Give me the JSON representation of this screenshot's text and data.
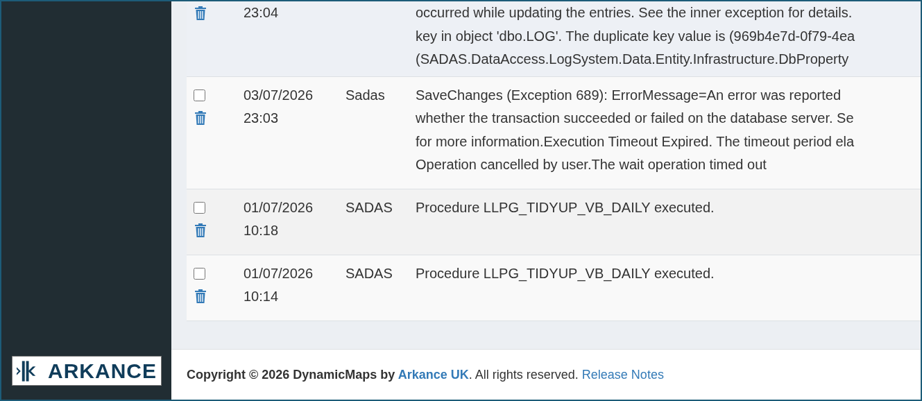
{
  "sidebar": {
    "logo_text": "ARKANCE"
  },
  "log_table": {
    "rows": [
      {
        "date": "",
        "time": "23:04",
        "user": "",
        "highlighted": true,
        "message_lines": [
          "occurred while updating the entries. See the inner exception for details.",
          "key in object 'dbo.LOG'. The duplicate key value is (969b4e7d-0f79-4ea",
          "(SADAS.DataAccess.LogSystem.Data.Entity.Infrastructure.DbProperty"
        ]
      },
      {
        "checked": false,
        "date": "03/07/2026",
        "time": "23:03",
        "user": "Sadas",
        "highlighted": false,
        "message_lines": [
          "SaveChanges (Exception 689): ErrorMessage=An error was reported",
          "whether the transaction succeeded or failed on the database server. Se",
          "for more information.Execution Timeout Expired. The timeout period ela",
          "Operation cancelled by user.The wait operation timed out"
        ]
      },
      {
        "checked": false,
        "date": "01/07/2026",
        "time": "10:18",
        "user": "SADAS",
        "highlighted": false,
        "message_lines": [
          "Procedure LLPG_TIDYUP_VB_DAILY executed."
        ]
      },
      {
        "checked": false,
        "date": "01/07/2026",
        "time": "10:14",
        "user": "SADAS",
        "highlighted": false,
        "message_lines": [
          "Procedure LLPG_TIDYUP_VB_DAILY executed."
        ]
      }
    ]
  },
  "footer": {
    "copyright": "Copyright © 2026 DynamicMaps by",
    "company_link": "Arkance UK",
    "rights": ". All rights reserved.",
    "release_notes_link": "Release Notes"
  }
}
